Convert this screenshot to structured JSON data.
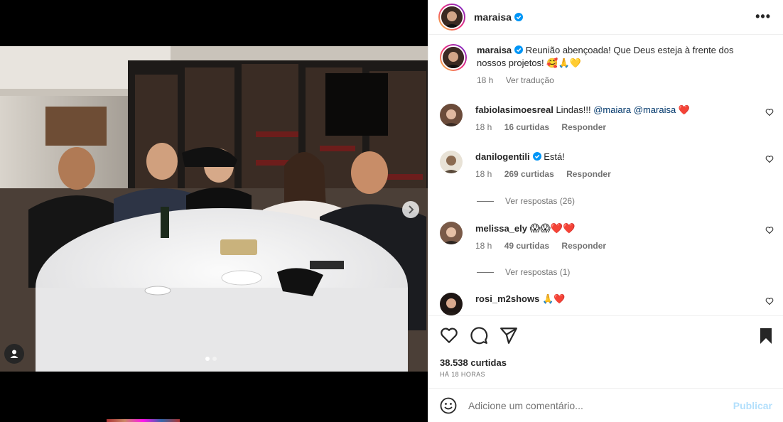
{
  "post": {
    "author": "maraisa",
    "caption": "Reunião abençoada! Que Deus esteja à frente dos nossos projetos! 🥰🙏💛",
    "caption_time": "18 h",
    "translate": "Ver tradução",
    "likes": "38.538 curtidas",
    "time_ago": "HÁ 18 HORAS"
  },
  "comments": [
    {
      "user": "fabiolasimoesreal",
      "text": "Lindas!!! ",
      "mentions": "@maiara @maraisa",
      "emoji": "❤️",
      "time": "18 h",
      "likes": "16 curtidas",
      "reply": "Responder"
    },
    {
      "user": "danilogentili",
      "text": "Está!",
      "time": "18 h",
      "likes": "269 curtidas",
      "reply": "Responder",
      "view_replies": "Ver respostas (26)"
    },
    {
      "user": "melissa_ely",
      "text": "😱😱❤️❤️",
      "time": "18 h",
      "likes": "49 curtidas",
      "reply": "Responder",
      "view_replies": "Ver respostas (1)"
    },
    {
      "user": "rosi_m2shows",
      "text": "🙏❤️"
    }
  ],
  "comment_box": {
    "placeholder": "Adicione um comentário...",
    "publish": "Publicar"
  },
  "colors": {
    "verified": "#0095f6",
    "heart_red": "#ed4956",
    "publish_disabled": "#b2dffc",
    "muted_text": "#737373"
  },
  "icons": [
    "tag-user-icon",
    "chevron-right-icon",
    "heart-icon",
    "comment-icon",
    "share-icon",
    "bookmark-icon",
    "emoji-icon",
    "more-options-icon"
  ]
}
